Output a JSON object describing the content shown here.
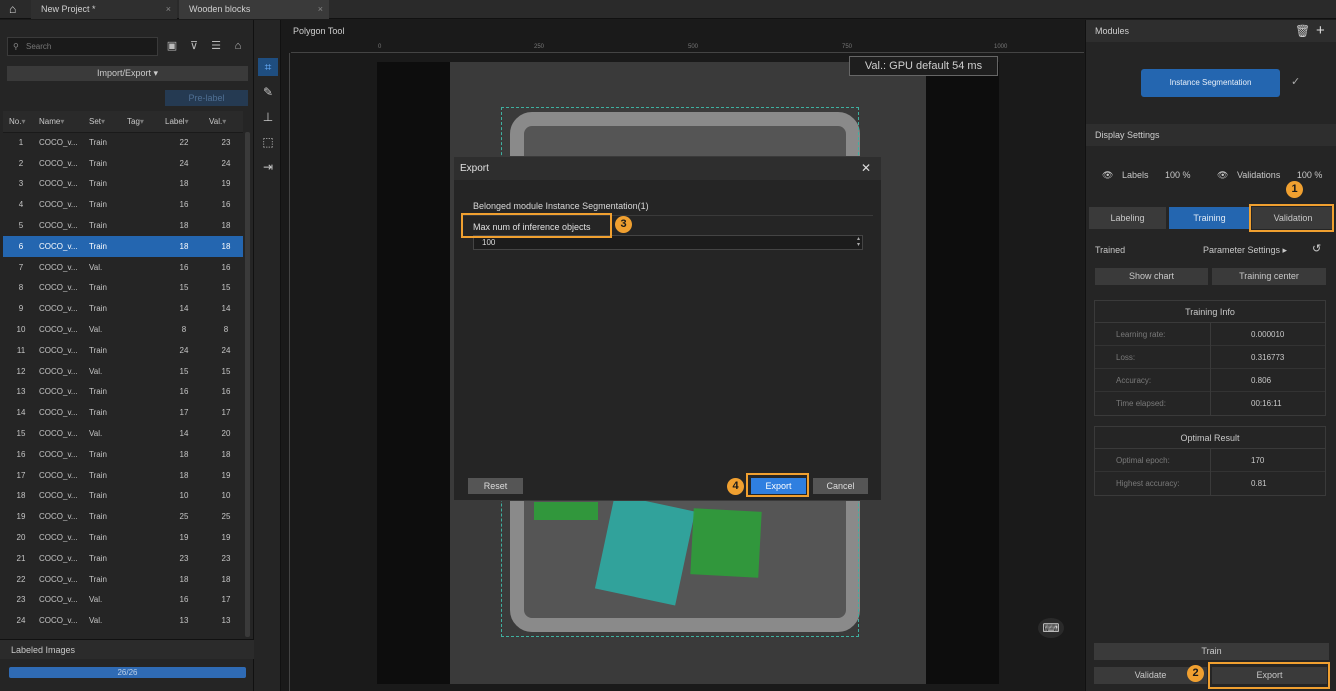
{
  "tabs": [
    {
      "label": "New Project *"
    },
    {
      "label": "Wooden blocks"
    }
  ],
  "left": {
    "search_placeholder": "Search",
    "import_export": "Import/Export",
    "pre_label": "Pre-label",
    "columns": [
      "No.",
      "Name",
      "Set",
      "Tag",
      "Label",
      "Val."
    ],
    "rows": [
      [
        "1",
        "COCO_v...",
        "Train",
        "",
        "22",
        "23"
      ],
      [
        "2",
        "COCO_v...",
        "Train",
        "",
        "24",
        "24"
      ],
      [
        "3",
        "COCO_v...",
        "Train",
        "",
        "18",
        "19"
      ],
      [
        "4",
        "COCO_v...",
        "Train",
        "",
        "16",
        "16"
      ],
      [
        "5",
        "COCO_v...",
        "Train",
        "",
        "18",
        "18"
      ],
      [
        "6",
        "COCO_v...",
        "Train",
        "",
        "18",
        "18"
      ],
      [
        "7",
        "COCO_v...",
        "Val.",
        "",
        "16",
        "16"
      ],
      [
        "8",
        "COCO_v...",
        "Train",
        "",
        "15",
        "15"
      ],
      [
        "9",
        "COCO_v...",
        "Train",
        "",
        "14",
        "14"
      ],
      [
        "10",
        "COCO_v...",
        "Val.",
        "",
        "8",
        "8"
      ],
      [
        "11",
        "COCO_v...",
        "Train",
        "",
        "24",
        "24"
      ],
      [
        "12",
        "COCO_v...",
        "Val.",
        "",
        "15",
        "15"
      ],
      [
        "13",
        "COCO_v...",
        "Train",
        "",
        "16",
        "16"
      ],
      [
        "14",
        "COCO_v...",
        "Train",
        "",
        "17",
        "17"
      ],
      [
        "15",
        "COCO_v...",
        "Val.",
        "",
        "14",
        "20"
      ],
      [
        "16",
        "COCO_v...",
        "Train",
        "",
        "18",
        "18"
      ],
      [
        "17",
        "COCO_v...",
        "Train",
        "",
        "18",
        "19"
      ],
      [
        "18",
        "COCO_v...",
        "Train",
        "",
        "10",
        "10"
      ],
      [
        "19",
        "COCO_v...",
        "Train",
        "",
        "25",
        "25"
      ],
      [
        "20",
        "COCO_v...",
        "Train",
        "",
        "19",
        "19"
      ],
      [
        "21",
        "COCO_v...",
        "Train",
        "",
        "23",
        "23"
      ],
      [
        "22",
        "COCO_v...",
        "Train",
        "",
        "18",
        "18"
      ],
      [
        "23",
        "COCO_v...",
        "Val.",
        "",
        "16",
        "17"
      ],
      [
        "24",
        "COCO_v...",
        "Val.",
        "",
        "13",
        "13"
      ]
    ],
    "selected_row": 6,
    "labeled_images_label": "Labeled Images",
    "labeled_progress": "26/26"
  },
  "center": {
    "title": "Polygon Tool",
    "ruler_ticks": [
      "0",
      "250",
      "500",
      "750",
      "1000"
    ],
    "gpu_label": "Val.:  GPU default 54 ms"
  },
  "right": {
    "modules_label": "Modules",
    "module_button": "Instance Segmentation",
    "display_settings": "Display Settings",
    "labels_label": "Labels",
    "labels_value": "100 %",
    "validations_label": "Validations",
    "validations_value": "100 %",
    "tabs": [
      "Labeling",
      "Training",
      "Validation"
    ],
    "trained_label": "Trained",
    "param_settings": "Parameter Settings",
    "show_chart": "Show chart",
    "training_center": "Training center",
    "training_info_title": "Training Info",
    "training_info": [
      {
        "k": "Learning rate:",
        "v": "0.000010"
      },
      {
        "k": "Loss:",
        "v": "0.316773"
      },
      {
        "k": "Accuracy:",
        "v": "0.806"
      },
      {
        "k": "Time elapsed:",
        "v": "00:16:11"
      }
    ],
    "optimal_title": "Optimal Result",
    "optimal": [
      {
        "k": "Optimal epoch:",
        "v": "170"
      },
      {
        "k": "Highest accuracy:",
        "v": "0.81"
      }
    ],
    "train_button": "Train",
    "validate_button": "Validate",
    "export_button": "Export"
  },
  "dialog": {
    "title": "Export",
    "module_line": "Belonged module Instance Segmentation(1)",
    "max_label": "Max num of inference objects",
    "max_value": "100",
    "reset": "Reset",
    "export": "Export",
    "cancel": "Cancel"
  },
  "callouts": [
    "1",
    "2",
    "3",
    "4"
  ],
  "colors": {
    "accent": "#2466b0",
    "callout": "#f0a030",
    "mask_green": "#2e9e3a",
    "mask_teal": "#2bb0a8"
  }
}
